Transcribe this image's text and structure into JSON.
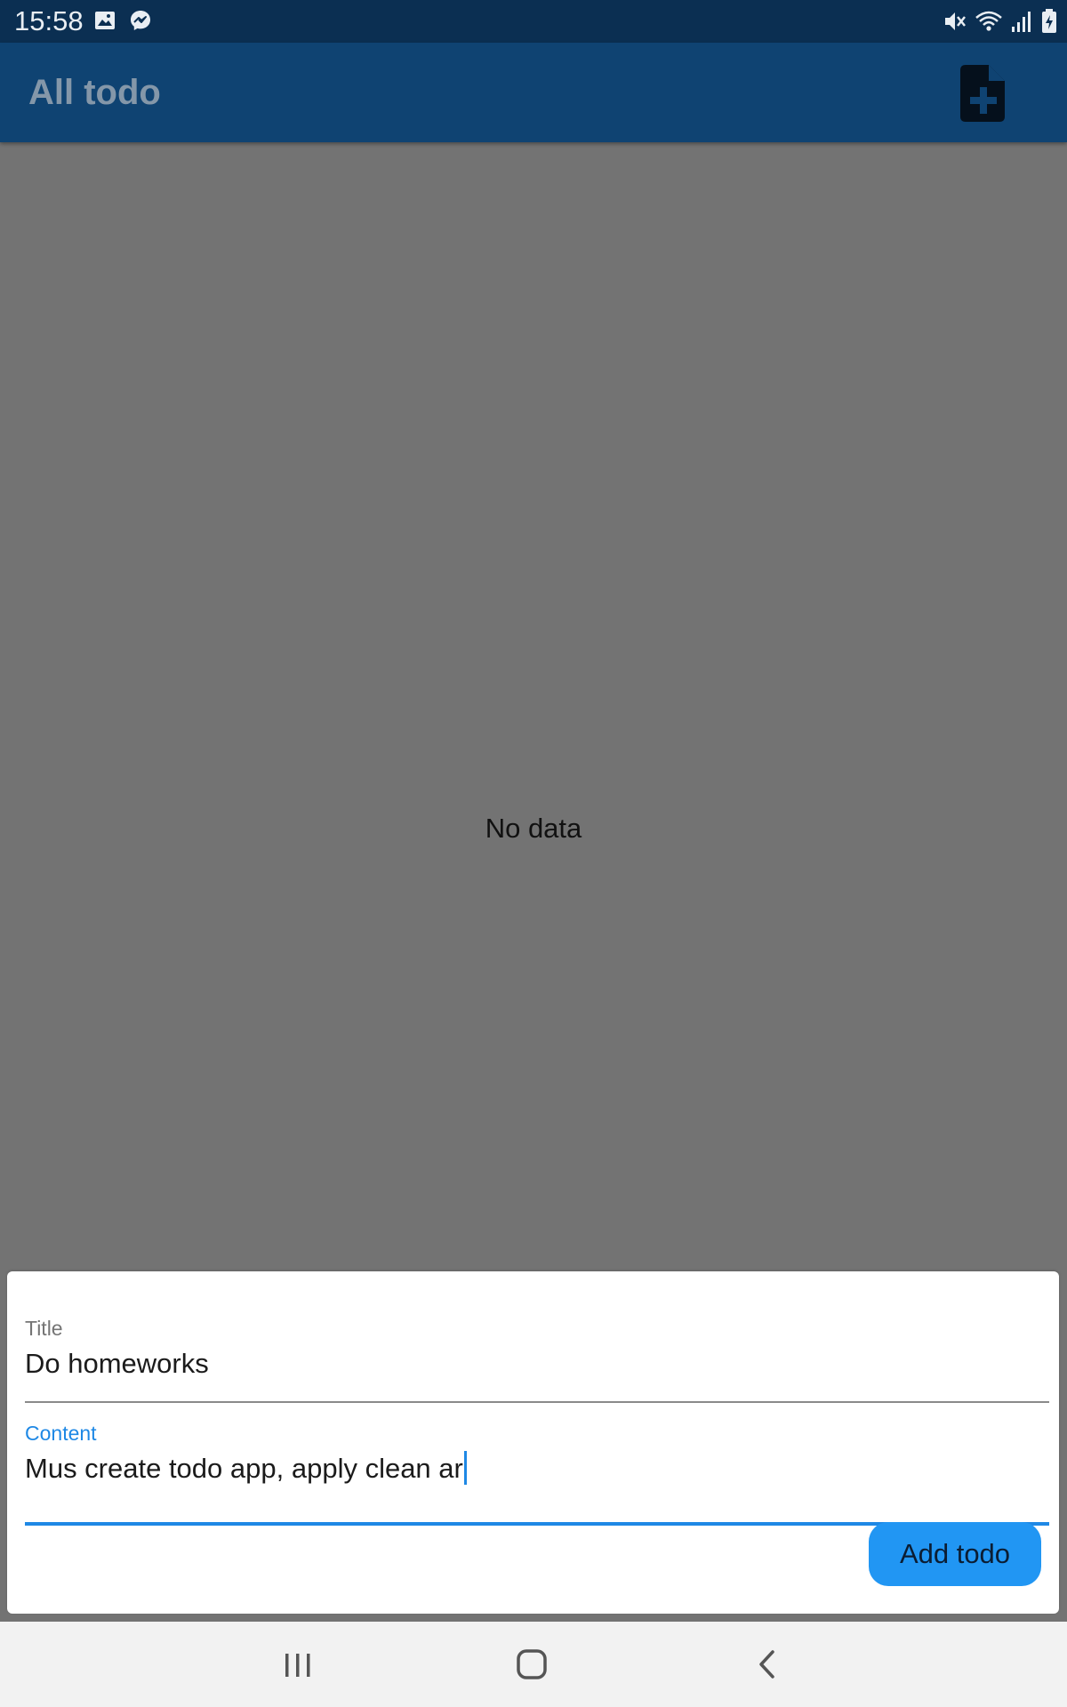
{
  "status_bar": {
    "time": "15:58",
    "left_icons": [
      "gallery-icon",
      "messenger-icon"
    ],
    "right_icons": [
      "mute-icon",
      "wifi-icon",
      "signal-icon",
      "battery-charging-icon"
    ]
  },
  "app_bar": {
    "title": "All todo",
    "action_icon": "note-add-icon"
  },
  "main": {
    "empty_text": "No data"
  },
  "sheet": {
    "title_field": {
      "label": "Title",
      "value": "Do homeworks"
    },
    "content_field": {
      "label": "Content",
      "value": "Mus create todo app, apply clean ar"
    },
    "submit_label": "Add todo"
  },
  "nav_bar": {
    "buttons": [
      "recents-icon",
      "home-icon",
      "back-icon"
    ]
  },
  "colors": {
    "status_bar": "#0b2f52",
    "app_bar": "#0f4372",
    "scrim_background": "#737373",
    "accent": "#2196f3",
    "focus_underline": "#1e88e5"
  }
}
